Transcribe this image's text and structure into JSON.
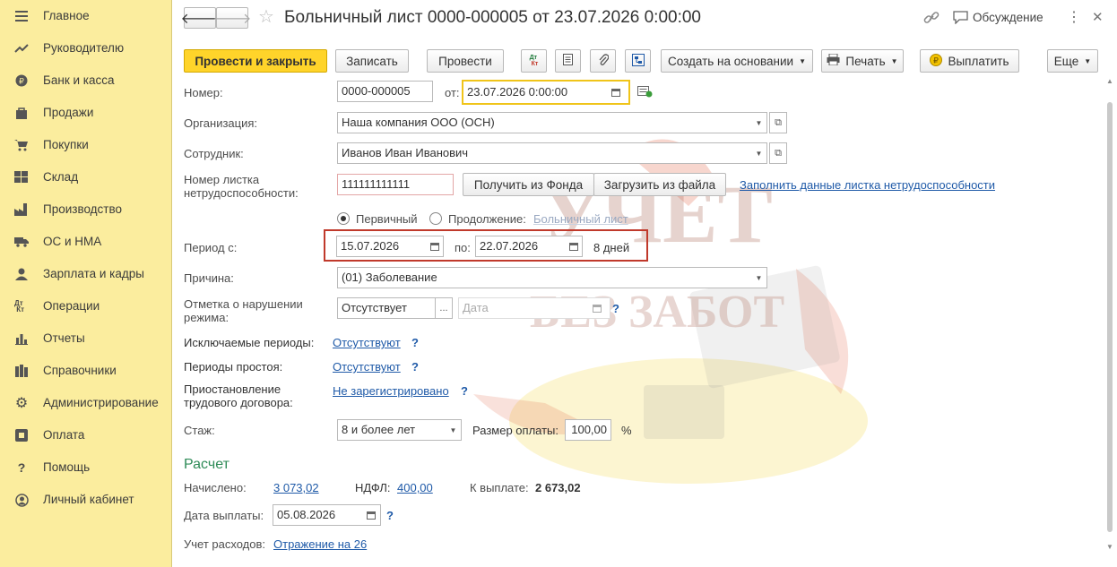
{
  "sidebar": {
    "items": [
      {
        "label": "Главное",
        "icon": "menu-icon"
      },
      {
        "label": "Руководителю",
        "icon": "trend-icon"
      },
      {
        "label": "Банк и касса",
        "icon": "coin-icon"
      },
      {
        "label": "Продажи",
        "icon": "bag-icon"
      },
      {
        "label": "Покупки",
        "icon": "cart-icon"
      },
      {
        "label": "Склад",
        "icon": "warehouse-icon"
      },
      {
        "label": "Производство",
        "icon": "factory-icon"
      },
      {
        "label": "ОС и НМА",
        "icon": "truck-icon"
      },
      {
        "label": "Зарплата и кадры",
        "icon": "person-icon"
      },
      {
        "label": "Операции",
        "icon": "dt-kt-icon"
      },
      {
        "label": "Отчеты",
        "icon": "bar-chart-icon"
      },
      {
        "label": "Справочники",
        "icon": "books-icon"
      },
      {
        "label": "Администрирование",
        "icon": "gear-icon"
      },
      {
        "label": "Оплата",
        "icon": "payment-icon"
      },
      {
        "label": "Помощь",
        "icon": "question-icon"
      },
      {
        "label": "Личный кабинет",
        "icon": "user-circle-icon"
      }
    ]
  },
  "header": {
    "title": "Больничный лист 0000-000005 от 23.07.2026 0:00:00",
    "discussion": "Обсуждение",
    "back_glyph": "🡐",
    "forward_glyph": "🡒",
    "star_glyph": "☆",
    "more_glyph": "⋮",
    "close_glyph": "✕"
  },
  "toolbar": {
    "post_close": "Провести и закрыть",
    "save": "Записать",
    "post": "Провести",
    "create_based": "Создать на основании",
    "print": "Печать",
    "pay": "Выплатить",
    "more": "Еще"
  },
  "form": {
    "number_label": "Номер:",
    "number_value": "0000-000005",
    "date_label": "от:",
    "date_value": "23.07.2026  0:00:00",
    "org_label": "Организация:",
    "org_value": "Наша компания ООО (ОСН)",
    "employee_label": "Сотрудник:",
    "employee_value": "Иванов Иван Иванович",
    "sheet_label_1": "Номер листка",
    "sheet_label_2": "нетрудоспособности:",
    "sheet_value": "111111111111",
    "get_from_fund": "Получить из Фонда",
    "load_from_file": "Загрузить из файла",
    "fill_link": "Заполнить данные листка нетрудоспособности",
    "primary": "Первичный",
    "continuation": "Продолжение:",
    "sick_leave_ref": "Больничный лист",
    "period_label": "Период с:",
    "period_from": "15.07.2026",
    "period_to_label": "по:",
    "period_to": "22.07.2026",
    "days": "8 дней",
    "reason_label": "Причина:",
    "reason_value": "(01) Заболевание",
    "violation_label_1": "Отметка о нарушении",
    "violation_label_2": "режима:",
    "violation_value": "Отсутствует",
    "violation_date_placeholder": "Дата",
    "excluded_label": "Исключаемые периоды:",
    "excluded_value": "Отсутствуют",
    "idle_label": "Периоды простоя:",
    "idle_value": "Отсутствуют",
    "suspension_label_1": "Приостановление",
    "suspension_label_2": "трудового договора:",
    "suspension_value": "Не зарегистрировано",
    "seniority_label": "Стаж:",
    "seniority_value": "8 и более лет",
    "pay_rate_label": "Размер оплаты:",
    "pay_rate_value": "100,00",
    "percent": "%",
    "q": "?"
  },
  "calc": {
    "title": "Расчет",
    "accrued_label": "Начислено:",
    "accrued_value": "3 073,02",
    "ndfl_label": "НДФЛ:",
    "ndfl_value": "400,00",
    "to_pay_label": "К выплате:",
    "to_pay_value": "2 673,02",
    "pay_date_label": "Дата выплаты:",
    "pay_date_value": "05.08.2026",
    "expense_label": "Учет расходов:",
    "expense_value": "Отражение на 26"
  },
  "watermark": {
    "line1": "УЧЕТ",
    "line2": "БЕЗ ЗАБОТ"
  },
  "colors": {
    "sidebar": "#fbed9e",
    "primary_button": "#ffd42a",
    "link": "#1f5aa8",
    "highlight": "#c0392b",
    "section_title": "#2e8b57"
  }
}
